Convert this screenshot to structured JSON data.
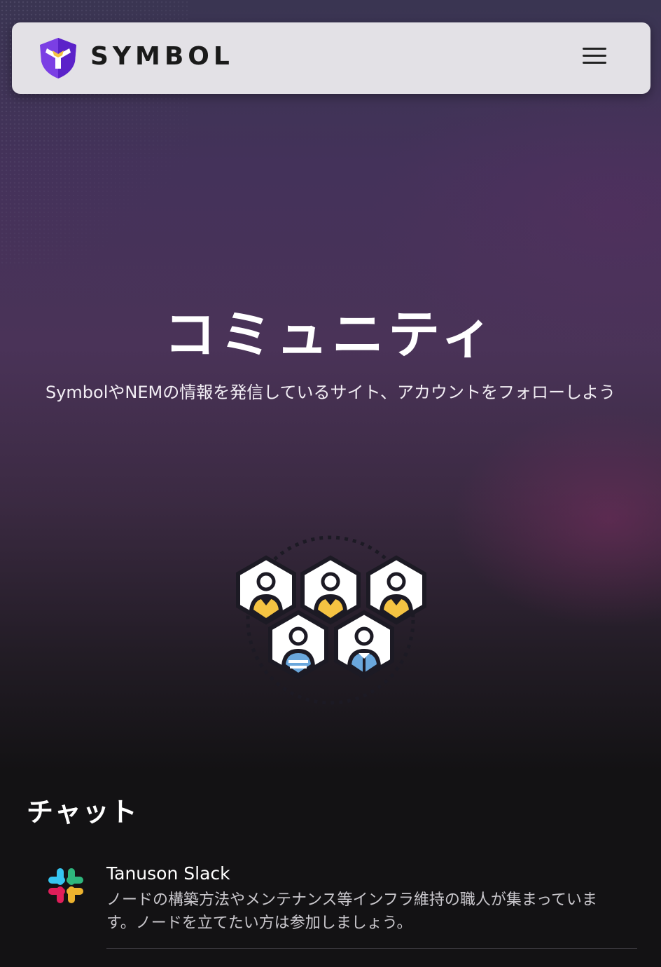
{
  "header": {
    "brand": "SYMBOL",
    "logo_icon": "symbol-logo-icon",
    "menu_icon": "hamburger-menu-icon",
    "brand_colors": {
      "logo_purple": "#7b3fe4",
      "logo_yellow": "#f5c342"
    }
  },
  "hero": {
    "title": "コミュニティ",
    "subtitle": "SymbolやNEMの情報を発信しているサイト、アカウントをフォローしよう",
    "illustration_icon": "community-people-icon"
  },
  "chat": {
    "section_title": "チャット",
    "items": [
      {
        "icon": "slack-icon",
        "name": "Tanuson Slack",
        "description": "ノードの構築方法やメンテナンス等インフラ維持の職人が集まっています。ノードを立てたい方は参加しましょう。"
      }
    ]
  }
}
